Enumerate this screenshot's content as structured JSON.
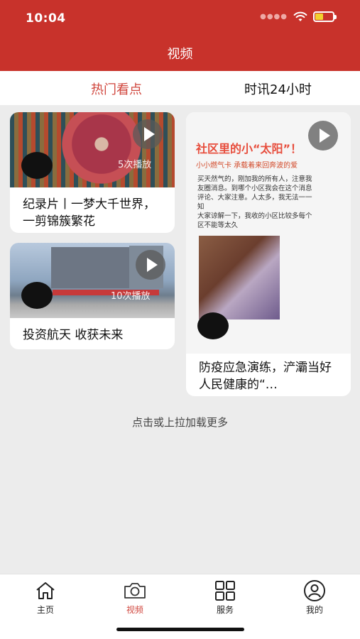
{
  "status_bar": {
    "time": "10:04"
  },
  "header": {
    "title": "视频"
  },
  "tabs": [
    {
      "label": "热门看点",
      "active": true
    },
    {
      "label": "时讯24小时",
      "active": false
    }
  ],
  "videos": [
    {
      "title": "纪录片丨一梦大千世界，一剪锦簇繁花",
      "views": "5次播放"
    },
    {
      "title": "投资航天 收获未来",
      "views": "10次播放"
    },
    {
      "title": "防疫应急演练，浐灞当好人民健康的“…",
      "thumb_text": {
        "headline": "社区里的小“太阳”！",
        "subhead": "小小燃气卡 承载着来回奔波的爱",
        "body": [
          "买天然气的，刚加我的所有人，注意我",
          "友圈消息。到哪个小区我会在这个消息",
          "评论、大家注意。人太多，我无法一一",
          "知",
          "大家谅解一下，我收的小区比较多每个",
          "区不能等太久"
        ]
      }
    }
  ],
  "load_more": "点击或上拉加载更多",
  "bottom_nav": [
    {
      "label": "主页",
      "icon": "home-icon",
      "active": false
    },
    {
      "label": "视频",
      "icon": "camera-icon",
      "active": true
    },
    {
      "label": "服务",
      "icon": "grid-icon",
      "active": false
    },
    {
      "label": "我的",
      "icon": "user-icon",
      "active": false
    }
  ],
  "colors": {
    "brand_red": "#c8322b",
    "active_tab": "#d0463d"
  }
}
